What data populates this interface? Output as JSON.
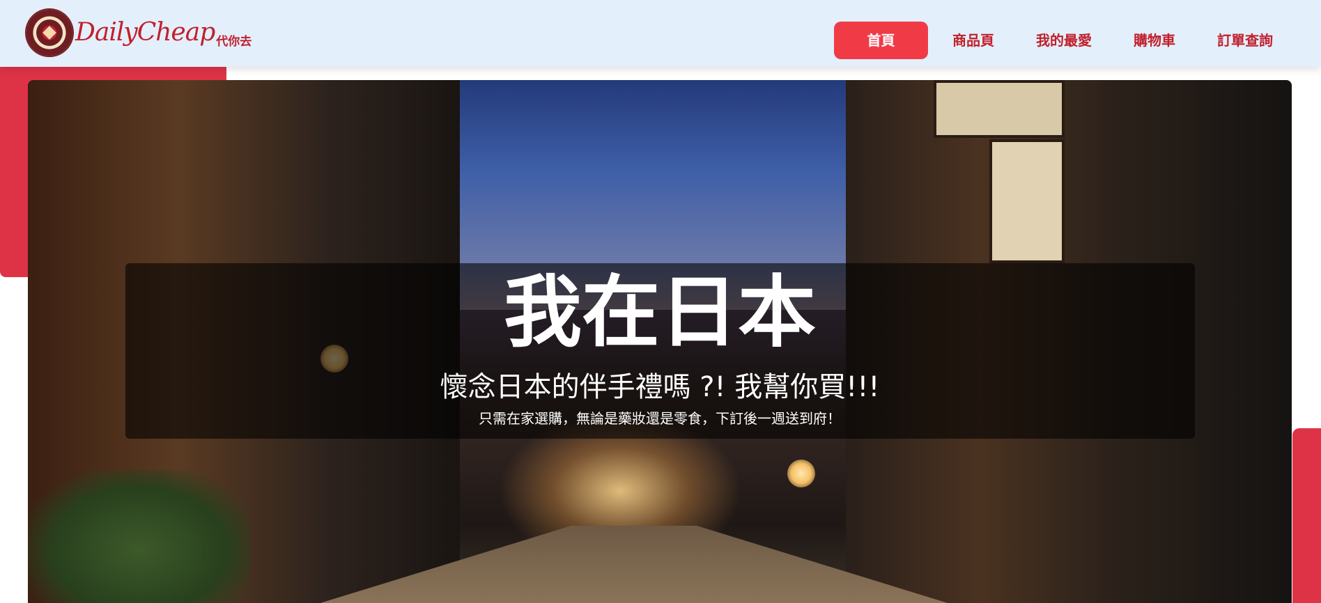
{
  "header": {
    "logo": {
      "brand": "DailyCheap",
      "sub": "代你去"
    },
    "nav": [
      {
        "label": "首頁",
        "active": true
      },
      {
        "label": "商品頁"
      },
      {
        "label": "我的最愛"
      },
      {
        "label": "購物車"
      },
      {
        "label": "訂單查詢"
      }
    ]
  },
  "hero": {
    "title": "我在日本",
    "subtitle": "懷念日本的伴手禮嗎 ?! 我幫你買!!!",
    "description": "只需在家選購，無論是藥妝還是零食，下訂後一週送到府！"
  },
  "colors": {
    "accent": "#de3347",
    "header_bg": "#e3effb",
    "brand_red": "#c0202c"
  }
}
